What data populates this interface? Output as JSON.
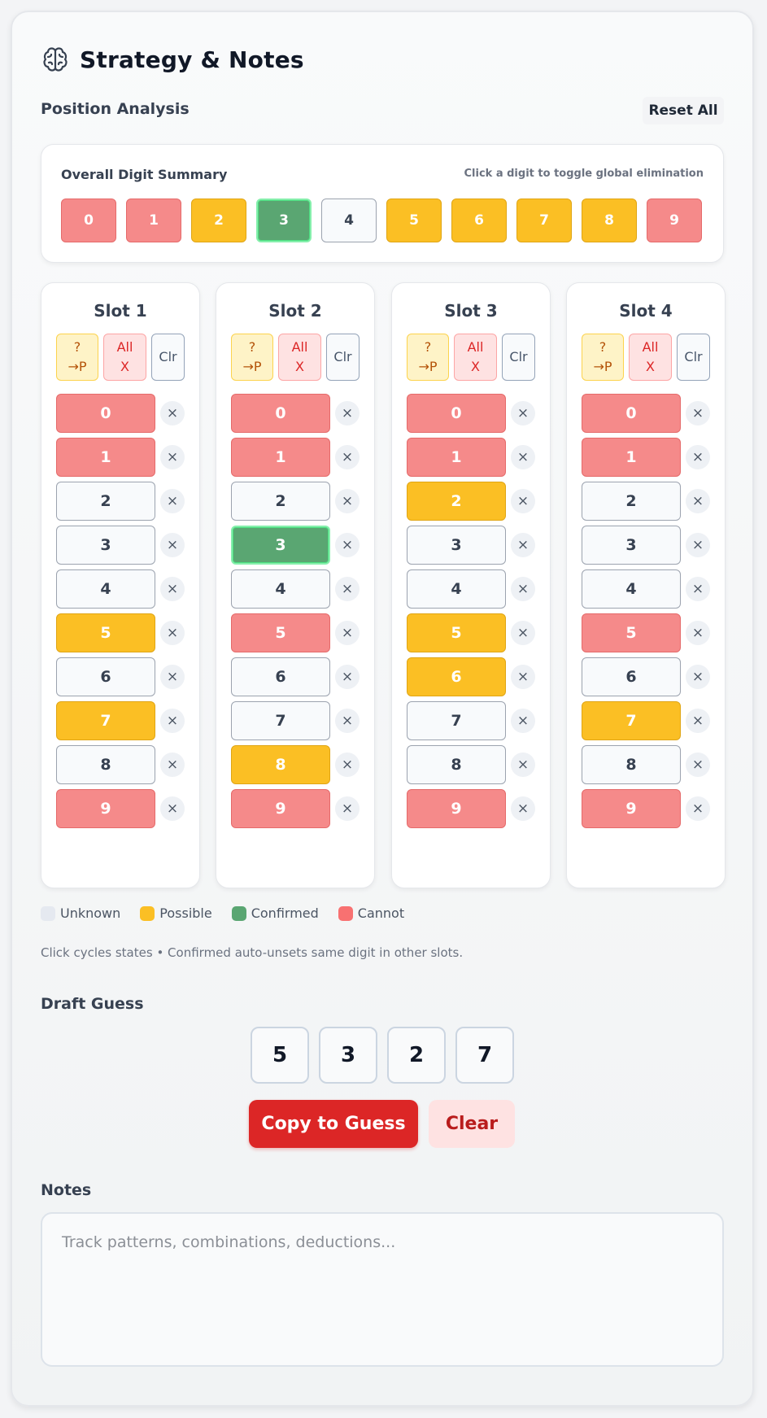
{
  "header": {
    "title": "Strategy & Notes",
    "icon": "brain-icon"
  },
  "position_analysis": {
    "label": "Position Analysis",
    "reset_label": "Reset All"
  },
  "summary": {
    "title": "Overall Digit Summary",
    "hint": "Click a digit to toggle global elimination",
    "digits": [
      {
        "digit": "0",
        "state": "cannot"
      },
      {
        "digit": "1",
        "state": "cannot"
      },
      {
        "digit": "2",
        "state": "possible"
      },
      {
        "digit": "3",
        "state": "confirmed"
      },
      {
        "digit": "4",
        "state": "unknown"
      },
      {
        "digit": "5",
        "state": "possible"
      },
      {
        "digit": "6",
        "state": "possible"
      },
      {
        "digit": "7",
        "state": "possible"
      },
      {
        "digit": "8",
        "state": "possible"
      },
      {
        "digit": "9",
        "state": "cannot"
      }
    ]
  },
  "slot_actions": {
    "possible_top": "?",
    "possible_bottom": "→P",
    "all_top": "All",
    "all_bottom": "X",
    "clear": "Clr"
  },
  "slots": [
    {
      "title": "Slot 1",
      "states": [
        "cannot",
        "cannot",
        "unknown",
        "unknown",
        "unknown",
        "possible",
        "unknown",
        "possible",
        "unknown",
        "cannot"
      ]
    },
    {
      "title": "Slot 2",
      "states": [
        "cannot",
        "cannot",
        "unknown",
        "confirmed",
        "unknown",
        "cannot",
        "unknown",
        "unknown",
        "possible",
        "cannot"
      ]
    },
    {
      "title": "Slot 3",
      "states": [
        "cannot",
        "cannot",
        "possible",
        "unknown",
        "unknown",
        "possible",
        "possible",
        "unknown",
        "unknown",
        "cannot"
      ]
    },
    {
      "title": "Slot 4",
      "states": [
        "cannot",
        "cannot",
        "unknown",
        "unknown",
        "unknown",
        "cannot",
        "unknown",
        "possible",
        "unknown",
        "cannot"
      ]
    }
  ],
  "digit_labels": [
    "0",
    "1",
    "2",
    "3",
    "4",
    "5",
    "6",
    "7",
    "8",
    "9"
  ],
  "x_glyph": "×",
  "legend": [
    {
      "label": "Unknown",
      "state": "unknown"
    },
    {
      "label": "Possible",
      "state": "possible"
    },
    {
      "label": "Confirmed",
      "state": "confirmed"
    },
    {
      "label": "Cannot",
      "state": "cannot"
    }
  ],
  "hint_text": "Click cycles states • Confirmed auto-unsets same digit in other slots.",
  "draft": {
    "label": "Draft Guess",
    "digits": [
      "5",
      "3",
      "2",
      "7"
    ],
    "copy_label": "Copy to Guess",
    "clear_label": "Clear"
  },
  "notes": {
    "label": "Notes",
    "placeholder": "Track patterns, combinations, deductions..."
  },
  "colors": {
    "cannot": "#f58a8a",
    "possible": "#fbbf24",
    "confirmed": "#5aa672",
    "unknown": "#f8fafc",
    "accent": "#dc2626"
  }
}
